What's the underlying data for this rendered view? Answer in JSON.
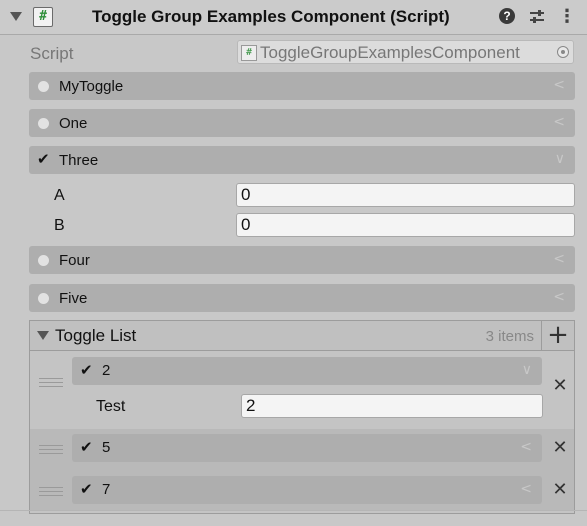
{
  "header": {
    "title": "Toggle Group Examples Component (Script)",
    "script_glyph": "#",
    "help_glyph": "?",
    "menu_glyph": "⋮"
  },
  "script_field": {
    "label": "Script",
    "value": "ToggleGroupExamplesComponent"
  },
  "toggles": [
    {
      "label": "MyToggle",
      "checked": false,
      "expanded": false
    },
    {
      "label": "One",
      "checked": false,
      "expanded": false
    },
    {
      "label": "Three",
      "checked": true,
      "expanded": true,
      "fields": [
        {
          "label": "A",
          "value": "0"
        },
        {
          "label": "B",
          "value": "0"
        }
      ]
    },
    {
      "label": "Four",
      "checked": false,
      "expanded": false
    },
    {
      "label": "Five",
      "checked": false,
      "expanded": false
    }
  ],
  "toggle_list": {
    "title": "Toggle List",
    "count_text": "3 items",
    "add_glyph": "+",
    "remove_glyph": "✕",
    "items": [
      {
        "label": "2",
        "checked": true,
        "expanded": true,
        "field": {
          "label": "Test",
          "value": "2"
        }
      },
      {
        "label": "5",
        "checked": true,
        "expanded": false
      },
      {
        "label": "7",
        "checked": true,
        "expanded": false
      }
    ]
  },
  "glyphs": {
    "check": "✔",
    "collapsed": "<",
    "expanded": "∨"
  },
  "colors": {
    "panel_bg": "#c8c8c8",
    "toggle_bg": "#aeaeae",
    "field_bg": "#f4f4f4",
    "script_icon": "#2f8f3a"
  }
}
